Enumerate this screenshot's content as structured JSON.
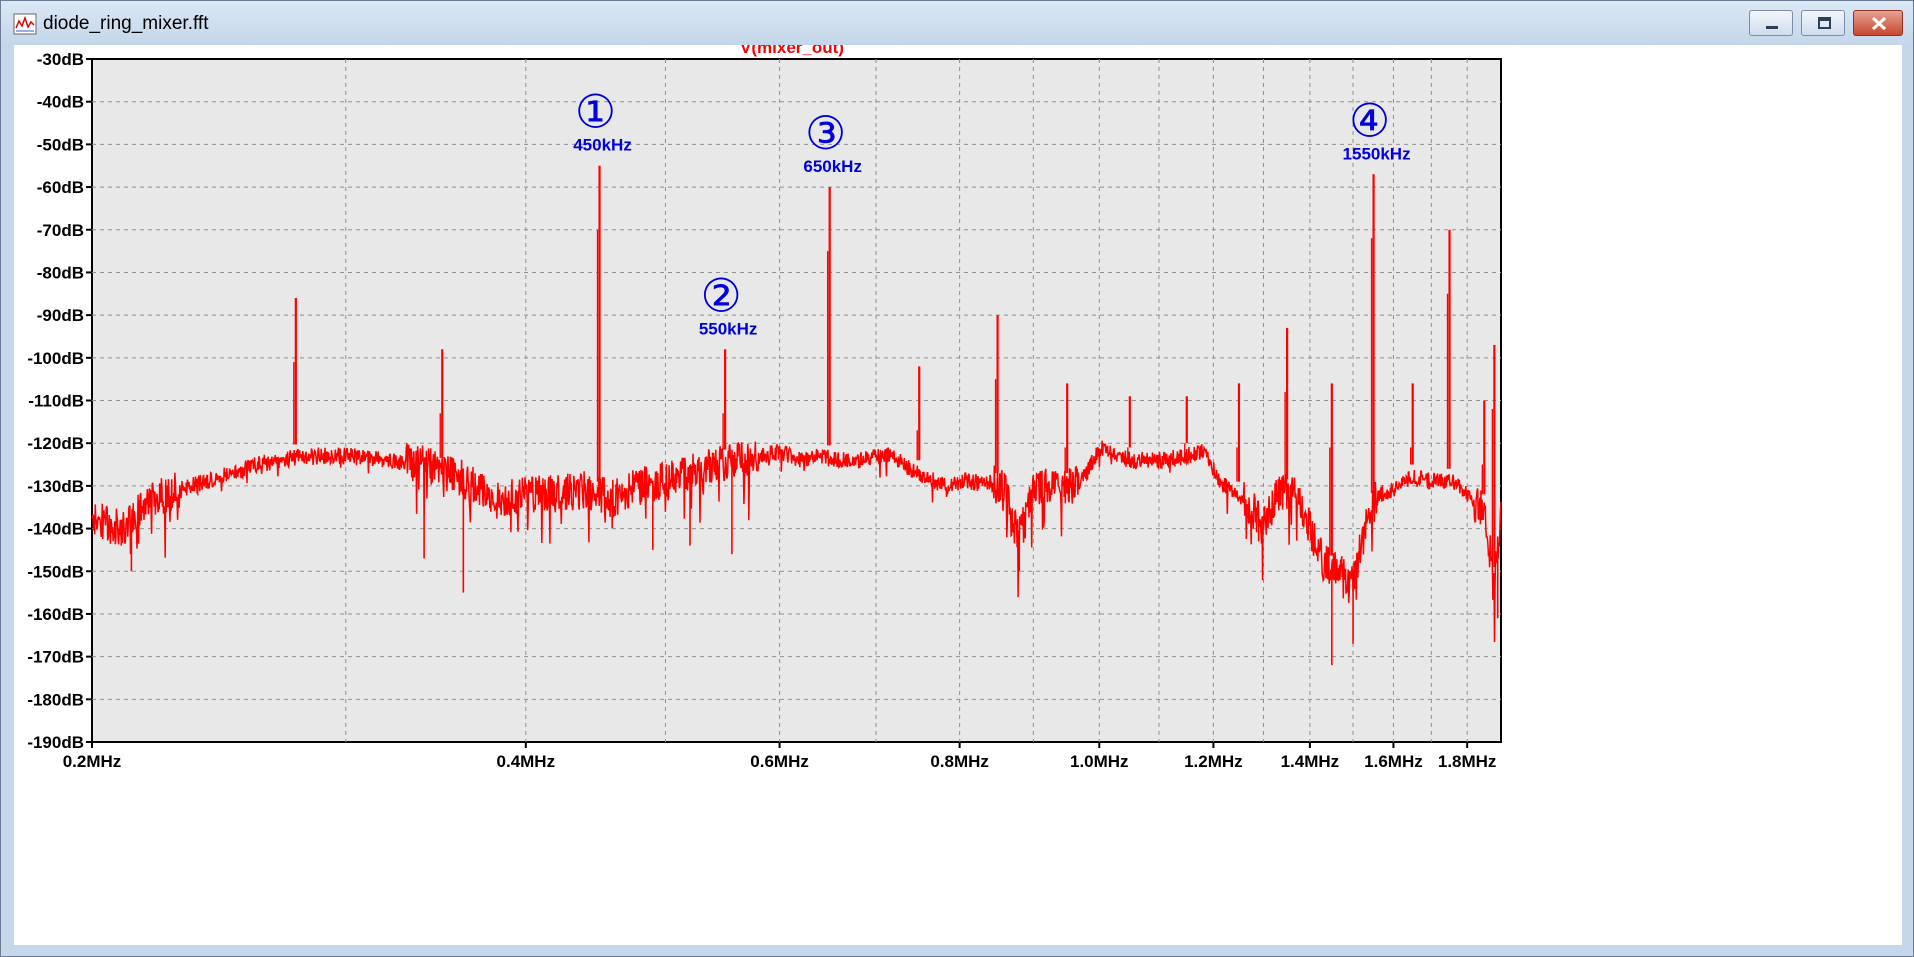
{
  "window": {
    "title": "diode_ring_mixer.fft",
    "icons": {
      "app": "waveform-icon",
      "minimize": "minimize-icon",
      "maximize": "maximize-icon",
      "close": "close-icon"
    }
  },
  "chart_data": {
    "type": "line",
    "title": "V(mixer_out)",
    "xlabel": "",
    "ylabel": "",
    "x_scale": "log",
    "xlim": [
      0.2,
      1.9
    ],
    "ylim": [
      -190,
      -30
    ],
    "grid": true,
    "colors": {
      "trace": "#ff0000",
      "title": "#ff0000",
      "annotation": "#0000dd",
      "background": "#e8e8e8",
      "grid": "#909090"
    },
    "x_ticks": [
      {
        "value": 0.2,
        "label": "0.2MHz"
      },
      {
        "value": 0.4,
        "label": "0.4MHz"
      },
      {
        "value": 0.6,
        "label": "0.6MHz"
      },
      {
        "value": 0.8,
        "label": "0.8MHz"
      },
      {
        "value": 1.0,
        "label": "1.0MHz"
      },
      {
        "value": 1.2,
        "label": "1.2MHz"
      },
      {
        "value": 1.4,
        "label": "1.4MHz"
      },
      {
        "value": 1.6,
        "label": "1.6MHz"
      },
      {
        "value": 1.8,
        "label": "1.8MHz"
      }
    ],
    "x_gridlines": [
      0.3,
      0.4,
      0.5,
      0.6,
      0.7,
      0.8,
      0.9,
      1.0,
      1.1,
      1.2,
      1.3,
      1.4,
      1.5,
      1.6,
      1.7,
      1.8
    ],
    "y_ticks": [
      {
        "value": -30,
        "label": "-30dB"
      },
      {
        "value": -40,
        "label": "-40dB"
      },
      {
        "value": -50,
        "label": "-50dB"
      },
      {
        "value": -60,
        "label": "-60dB"
      },
      {
        "value": -70,
        "label": "-70dB"
      },
      {
        "value": -80,
        "label": "-80dB"
      },
      {
        "value": -90,
        "label": "-90dB"
      },
      {
        "value": -100,
        "label": "-100dB"
      },
      {
        "value": -110,
        "label": "-110dB"
      },
      {
        "value": -120,
        "label": "-120dB"
      },
      {
        "value": -130,
        "label": "-130dB"
      },
      {
        "value": -140,
        "label": "-140dB"
      },
      {
        "value": -150,
        "label": "-150dB"
      },
      {
        "value": -160,
        "label": "-160dB"
      },
      {
        "value": -170,
        "label": "-170dB"
      },
      {
        "value": -180,
        "label": "-180dB"
      },
      {
        "value": -190,
        "label": "-190dB"
      }
    ],
    "series": [
      {
        "baseline": [
          [
            0.2,
            -138
          ],
          [
            0.21,
            -140
          ],
          [
            0.22,
            -133
          ],
          [
            0.24,
            -129
          ],
          [
            0.26,
            -125
          ],
          [
            0.28,
            -123
          ],
          [
            0.3,
            -123
          ],
          [
            0.32,
            -124
          ],
          [
            0.34,
            -125
          ],
          [
            0.36,
            -128
          ],
          [
            0.38,
            -133
          ],
          [
            0.4,
            -132
          ],
          [
            0.42,
            -132
          ],
          [
            0.44,
            -131
          ],
          [
            0.46,
            -133
          ],
          [
            0.48,
            -130
          ],
          [
            0.5,
            -129
          ],
          [
            0.52,
            -127
          ],
          [
            0.54,
            -125
          ],
          [
            0.56,
            -124
          ],
          [
            0.58,
            -123
          ],
          [
            0.6,
            -122
          ],
          [
            0.62,
            -124
          ],
          [
            0.64,
            -123
          ],
          [
            0.66,
            -124
          ],
          [
            0.68,
            -124
          ],
          [
            0.7,
            -123
          ],
          [
            0.72,
            -123
          ],
          [
            0.74,
            -126
          ],
          [
            0.76,
            -128
          ],
          [
            0.78,
            -130
          ],
          [
            0.8,
            -129
          ],
          [
            0.82,
            -129
          ],
          [
            0.84,
            -129
          ],
          [
            0.86,
            -131
          ],
          [
            0.87,
            -138
          ],
          [
            0.88,
            -142
          ],
          [
            0.89,
            -137
          ],
          [
            0.9,
            -131
          ],
          [
            0.93,
            -130
          ],
          [
            0.96,
            -130
          ],
          [
            0.98,
            -127
          ],
          [
            1.0,
            -121
          ],
          [
            1.02,
            -122
          ],
          [
            1.05,
            -124
          ],
          [
            1.1,
            -124
          ],
          [
            1.15,
            -123
          ],
          [
            1.18,
            -122
          ],
          [
            1.2,
            -126
          ],
          [
            1.22,
            -130
          ],
          [
            1.25,
            -132
          ],
          [
            1.28,
            -136
          ],
          [
            1.3,
            -140
          ],
          [
            1.33,
            -131
          ],
          [
            1.37,
            -132
          ],
          [
            1.4,
            -140
          ],
          [
            1.43,
            -148
          ],
          [
            1.46,
            -150
          ],
          [
            1.5,
            -152
          ],
          [
            1.53,
            -140
          ],
          [
            1.56,
            -132
          ],
          [
            1.6,
            -131
          ],
          [
            1.65,
            -128
          ],
          [
            1.7,
            -129
          ],
          [
            1.76,
            -129
          ],
          [
            1.8,
            -132
          ],
          [
            1.82,
            -134
          ],
          [
            1.85,
            -135
          ],
          [
            1.88,
            -152
          ],
          [
            1.9,
            -137
          ]
        ],
        "peaks": [
          [
            0.277,
            -86
          ],
          [
            0.35,
            -98
          ],
          [
            0.45,
            -55
          ],
          [
            0.55,
            -98
          ],
          [
            0.65,
            -60
          ],
          [
            0.75,
            -102
          ],
          [
            0.85,
            -90
          ],
          [
            0.95,
            -106
          ],
          [
            1.05,
            -109
          ],
          [
            1.15,
            -109
          ],
          [
            1.25,
            -106
          ],
          [
            1.35,
            -93
          ],
          [
            1.45,
            -106
          ],
          [
            1.55,
            -57
          ],
          [
            1.65,
            -106
          ],
          [
            1.75,
            -70
          ],
          [
            1.85,
            -110
          ],
          [
            1.88,
            -97
          ]
        ],
        "dips": [
          [
            0.213,
            -150
          ],
          [
            0.34,
            -147
          ],
          [
            0.362,
            -155
          ],
          [
            0.49,
            -145
          ],
          [
            0.52,
            -144
          ],
          [
            0.556,
            -146
          ],
          [
            0.88,
            -150
          ],
          [
            1.29,
            -143
          ],
          [
            1.45,
            -172
          ],
          [
            1.5,
            -167
          ],
          [
            1.89,
            -161
          ]
        ]
      }
    ],
    "annotations": [
      {
        "marker": "①",
        "label": "450kHz"
      },
      {
        "marker": "②",
        "label": "550kHz"
      },
      {
        "marker": "③",
        "label": "650kHz"
      },
      {
        "marker": "④",
        "label": "1550kHz"
      }
    ]
  }
}
